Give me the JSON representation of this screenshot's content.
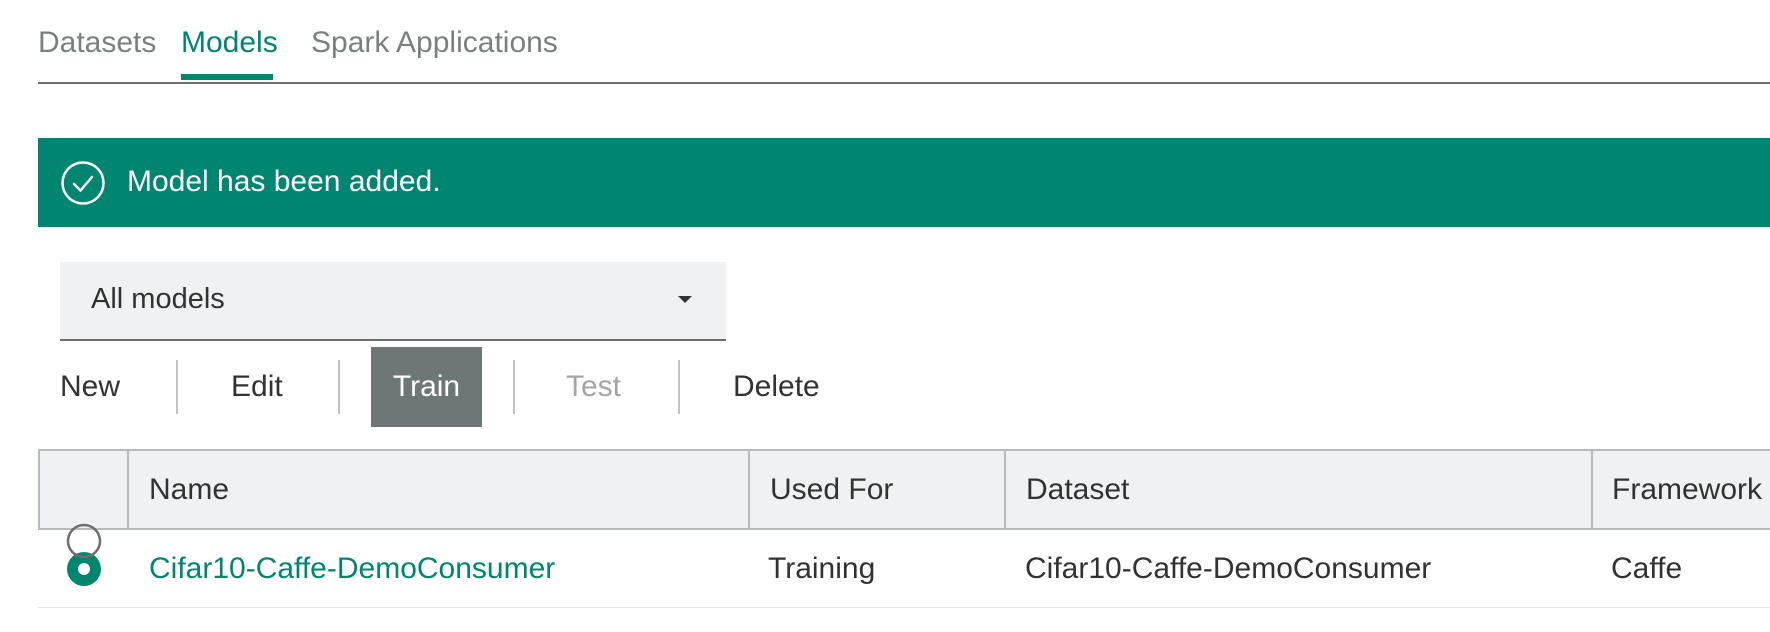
{
  "tabs": [
    {
      "label": "Datasets",
      "active": false
    },
    {
      "label": "Models",
      "active": true
    },
    {
      "label": "Spark Applications",
      "active": false
    }
  ],
  "notification": {
    "icon": "checkmark-circle-icon",
    "message": "Model has been added.",
    "color": "#008571"
  },
  "filter": {
    "selected": "All models",
    "icon": "caret-down-icon"
  },
  "toolbar": {
    "new_label": "New",
    "edit_label": "Edit",
    "train_label": "Train",
    "test_label": "Test",
    "delete_label": "Delete"
  },
  "table": {
    "columns": [
      "Name",
      "Used For",
      "Dataset",
      "Framework"
    ],
    "rows": [
      {
        "selected": true,
        "name": "Cifar10-Caffe-DemoConsumer",
        "used_for": "Training",
        "dataset": "Cifar10-Caffe-DemoConsumer",
        "framework": "Caffe"
      }
    ]
  },
  "colors": {
    "accent": "#00856f",
    "pressed_button": "#6d7777",
    "disabled_text": "#a5a5a5"
  }
}
